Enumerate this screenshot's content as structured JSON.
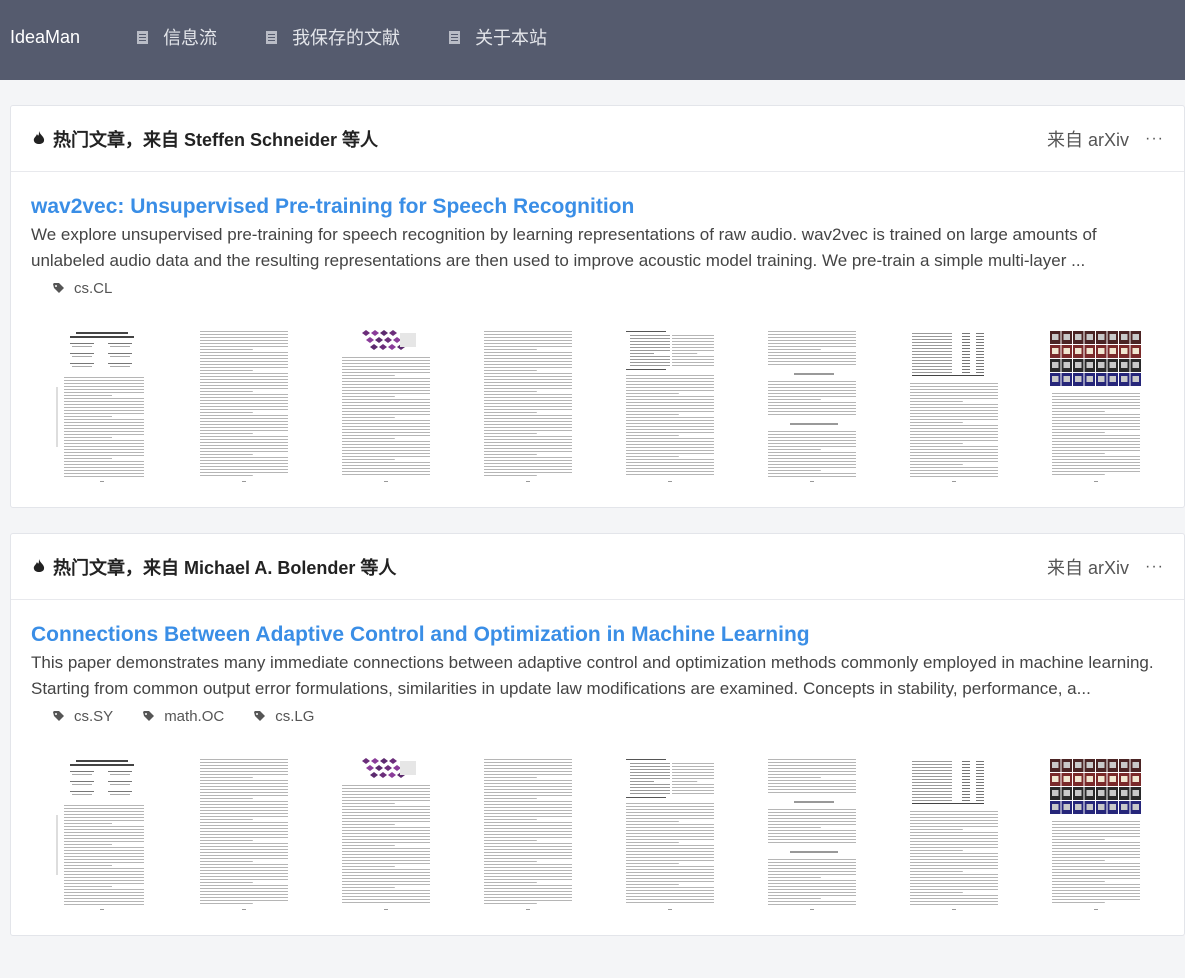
{
  "topbar": {
    "brand": "IdeaMan",
    "nav": [
      {
        "label": "信息流",
        "icon": "document-icon"
      },
      {
        "label": "我保存的文献",
        "icon": "document-icon"
      },
      {
        "label": "关于本站",
        "icon": "document-icon"
      }
    ]
  },
  "cards": [
    {
      "header": "热门文章，来自 Steffen Schneider 等人",
      "source": "来自 arXiv",
      "more": "···",
      "title": "wav2vec: Unsupervised Pre-training for Speech Recognition",
      "abstract": "We explore unsupervised pre-training for speech recognition by learning representations of raw audio. wav2vec is trained on large amounts of unlabeled audio data and the resulting representations are then used to improve acoustic model training. We pre-train a simple multi-layer ...",
      "tags": [
        "cs.CL"
      ],
      "thumbnails": [
        "page-1",
        "page-2",
        "page-3",
        "page-4",
        "page-5",
        "page-6",
        "page-7",
        "page-8"
      ]
    },
    {
      "header": "热门文章，来自 Michael A. Bolender 等人",
      "source": "来自 arXiv",
      "more": "···",
      "title": "Connections Between Adaptive Control and Optimization in Machine Learning",
      "abstract": "This paper demonstrates many immediate connections between adaptive control and optimization methods commonly employed in machine learning. Starting from common output error formulations, similarities in update law modifications are examined. Concepts in stability, performance, a...",
      "tags": [
        "cs.SY",
        "math.OC",
        "cs.LG"
      ],
      "thumbnails": [
        "page-1",
        "page-2",
        "page-3",
        "page-4",
        "page-5",
        "page-6",
        "page-7",
        "page-8"
      ]
    }
  ],
  "colors": {
    "topbar": "#555b6e",
    "link": "#3a8ee6",
    "background": "#f4f5f7"
  }
}
